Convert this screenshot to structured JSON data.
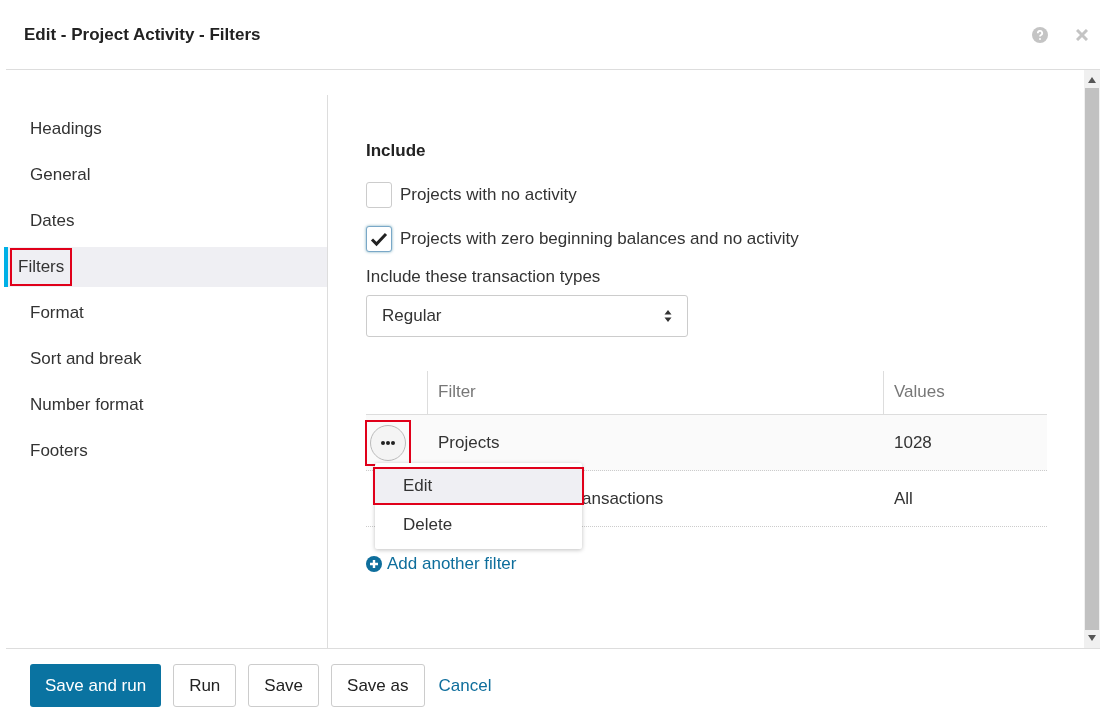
{
  "window": {
    "title": "Edit - Project Activity  - Filters"
  },
  "sidebar": {
    "items": [
      {
        "label": "Headings",
        "selected": false,
        "highlighted": false
      },
      {
        "label": "General",
        "selected": false,
        "highlighted": false
      },
      {
        "label": "Dates",
        "selected": false,
        "highlighted": false
      },
      {
        "label": "Filters",
        "selected": true,
        "highlighted": true
      },
      {
        "label": "Format",
        "selected": false,
        "highlighted": false
      },
      {
        "label": "Sort and break",
        "selected": false,
        "highlighted": false
      },
      {
        "label": "Number format",
        "selected": false,
        "highlighted": false
      },
      {
        "label": "Footers",
        "selected": false,
        "highlighted": false
      }
    ]
  },
  "include": {
    "heading": "Include",
    "options": [
      {
        "label": "Projects with no activity",
        "checked": false
      },
      {
        "label": "Projects with zero beginning balances and no activity",
        "checked": true
      }
    ],
    "types_label": "Include these transaction types",
    "types_value": "Regular"
  },
  "table": {
    "columns": [
      "Filter",
      "Values"
    ],
    "rows": [
      {
        "filter": "Projects",
        "values": "1028"
      },
      {
        "filter": "ansactions",
        "values": "All"
      }
    ]
  },
  "more_button": {
    "highlighted": true
  },
  "row_menu": {
    "items": [
      {
        "label": "Edit",
        "highlighted": true
      },
      {
        "label": "Delete",
        "highlighted": false
      }
    ]
  },
  "add_filter": "Add another filter",
  "buttons": [
    {
      "label": "Save and run",
      "kind": "primary"
    },
    {
      "label": "Run",
      "kind": "secondary"
    },
    {
      "label": "Save",
      "kind": "secondary"
    },
    {
      "label": "Save as",
      "kind": "secondary"
    },
    {
      "label": "Cancel",
      "kind": "link"
    }
  ]
}
